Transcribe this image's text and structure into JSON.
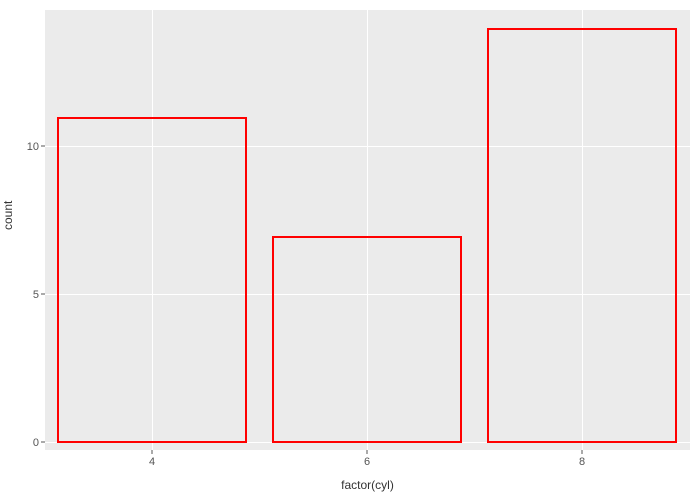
{
  "chart_data": {
    "type": "bar",
    "categories": [
      "4",
      "6",
      "8"
    ],
    "values": [
      11,
      7,
      14
    ],
    "title": "",
    "xlabel": "factor(cyl)",
    "ylabel": "count",
    "ylim": [
      0,
      14.5
    ],
    "yticks": [
      0,
      5,
      10
    ],
    "bar_outline": "#ff0000",
    "bar_fill": "transparent"
  }
}
